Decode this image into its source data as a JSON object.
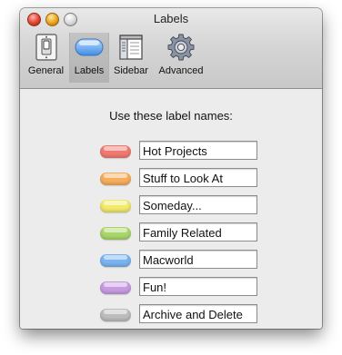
{
  "window": {
    "title": "Labels"
  },
  "toolbar": {
    "items": [
      {
        "label": "General",
        "icon": "light-switch-icon",
        "selected": false
      },
      {
        "label": "Labels",
        "icon": "label-pill-icon",
        "selected": true
      },
      {
        "label": "Sidebar",
        "icon": "sidebar-window-icon",
        "selected": false
      },
      {
        "label": "Advanced",
        "icon": "gear-icon",
        "selected": false
      }
    ]
  },
  "heading": "Use these label names:",
  "labels": [
    {
      "name": "Hot Projects",
      "color": "#f07a72"
    },
    {
      "name": "Stuff to Look At",
      "color": "#f5ad5e"
    },
    {
      "name": "Someday...",
      "color": "#f2ea6a"
    },
    {
      "name": "Family Related",
      "color": "#a9d66a"
    },
    {
      "name": "Macworld",
      "color": "#7ab4f0"
    },
    {
      "name": "Fun!",
      "color": "#c79be0"
    },
    {
      "name": "Archive and Delete",
      "color": "#bdbdbd"
    }
  ]
}
